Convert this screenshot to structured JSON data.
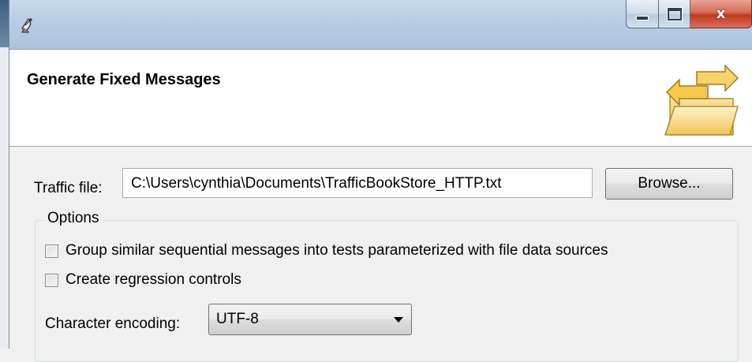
{
  "window": {
    "title_icon": "satellite-dish-icon",
    "close_glyph": "x"
  },
  "banner": {
    "title": "Generate Fixed Messages",
    "icon": "folder-exchange-icon"
  },
  "form": {
    "traffic_label": "Traffic file:",
    "traffic_value": "C:\\Users\\cynthia\\Documents\\TrafficBookStore_HTTP.txt",
    "browse_label": "Browse...",
    "options_legend": "Options",
    "options": [
      {
        "label": "Group similar sequential messages into tests parameterized with file data sources",
        "checked": false
      },
      {
        "label": "Create regression controls",
        "checked": false
      }
    ],
    "encoding_label": "Character encoding:",
    "encoding_value": "UTF-8"
  }
}
